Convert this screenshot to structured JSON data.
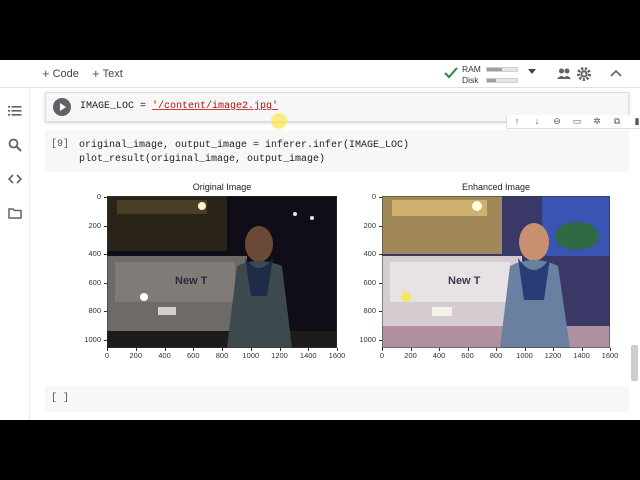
{
  "toolbar": {
    "code_label": "Code",
    "text_label": "Text",
    "ram_label": "RAM",
    "disk_label": "Disk",
    "ram_usage": 0.5,
    "disk_usage": 0.3
  },
  "cell1": {
    "code_prefix": "IMAGE_LOC = ",
    "code_string": "'/content/image2.jpg'"
  },
  "cell2": {
    "number": "[9]",
    "line1": "original_image, output_image = inferer.infer(IMAGE_LOC)",
    "line2": "plot_result(original_image, output_image)"
  },
  "plots": {
    "left_title": "Original Image",
    "right_title": "Enhanced Image",
    "y_ticks": [
      "0",
      "200",
      "400",
      "600",
      "800",
      "1000"
    ],
    "x_ticks": [
      "0",
      "200",
      "400",
      "600",
      "800",
      "1000",
      "1200",
      "1400",
      "1600"
    ],
    "bus_text": "New T"
  },
  "cell3": {
    "prompt": "[ ]"
  },
  "colors": {
    "accent_green": "#1e8e3e",
    "icon_gray": "#5f6368"
  }
}
